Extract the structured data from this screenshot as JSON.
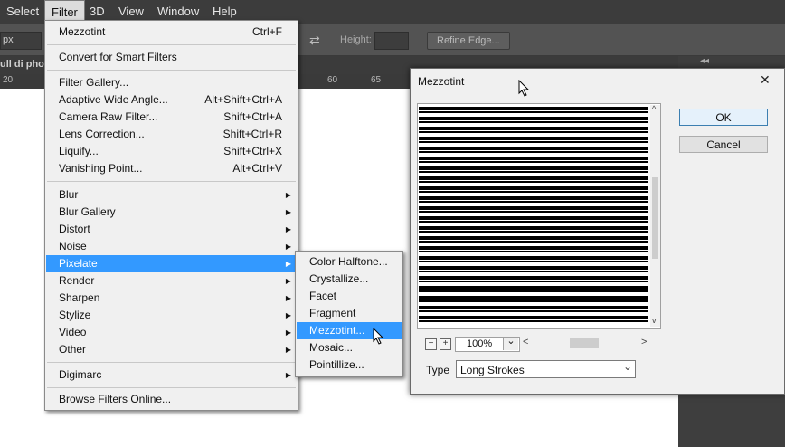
{
  "menubar": {
    "items": [
      {
        "label": "Select"
      },
      {
        "label": "Filter"
      },
      {
        "label": "3D"
      },
      {
        "label": "View"
      },
      {
        "label": "Window"
      },
      {
        "label": "Help"
      }
    ]
  },
  "options": {
    "size_value": "px",
    "height_label": "Height:",
    "refine_edge": "Refine Edge..."
  },
  "document": {
    "tab_title": "ull di pho",
    "ruler_marks": [
      "20",
      "60",
      "65"
    ]
  },
  "filter_menu": {
    "last_filter": {
      "label": "Mezzotint",
      "shortcut": "Ctrl+F"
    },
    "smart_filters": "Convert for Smart Filters",
    "items_a": [
      {
        "label": "Filter Gallery...",
        "shortcut": ""
      },
      {
        "label": "Adaptive Wide Angle...",
        "shortcut": "Alt+Shift+Ctrl+A"
      },
      {
        "label": "Camera Raw Filter...",
        "shortcut": "Shift+Ctrl+A"
      },
      {
        "label": "Lens Correction...",
        "shortcut": "Shift+Ctrl+R"
      },
      {
        "label": "Liquify...",
        "shortcut": "Shift+Ctrl+X"
      },
      {
        "label": "Vanishing Point...",
        "shortcut": "Alt+Ctrl+V"
      }
    ],
    "items_b": [
      {
        "label": "Blur"
      },
      {
        "label": "Blur Gallery"
      },
      {
        "label": "Distort"
      },
      {
        "label": "Noise"
      },
      {
        "label": "Pixelate"
      },
      {
        "label": "Render"
      },
      {
        "label": "Sharpen"
      },
      {
        "label": "Stylize"
      },
      {
        "label": "Video"
      },
      {
        "label": "Other"
      }
    ],
    "digimarc": "Digimarc",
    "browse": "Browse Filters Online..."
  },
  "pixelate_menu": {
    "items": [
      {
        "label": "Color Halftone..."
      },
      {
        "label": "Crystallize..."
      },
      {
        "label": "Facet"
      },
      {
        "label": "Fragment"
      },
      {
        "label": "Mezzotint..."
      },
      {
        "label": "Mosaic..."
      },
      {
        "label": "Pointillize..."
      }
    ]
  },
  "dialog": {
    "title": "Mezzotint",
    "ok": "OK",
    "cancel": "Cancel",
    "zoom": "100%",
    "type_label": "Type",
    "type_value": "Long Strokes",
    "glyphs": {
      "close": "✕",
      "minus": "−",
      "plus": "+",
      "chevron_down": "⌄",
      "arrow_left": "<",
      "arrow_right": ">",
      "arrow_up": "^",
      "arrow_down": "v"
    }
  },
  "colors": {
    "highlight": "#3399ff",
    "menu_bg": "#f0f0f0",
    "chrome": "#3c3c3c"
  }
}
